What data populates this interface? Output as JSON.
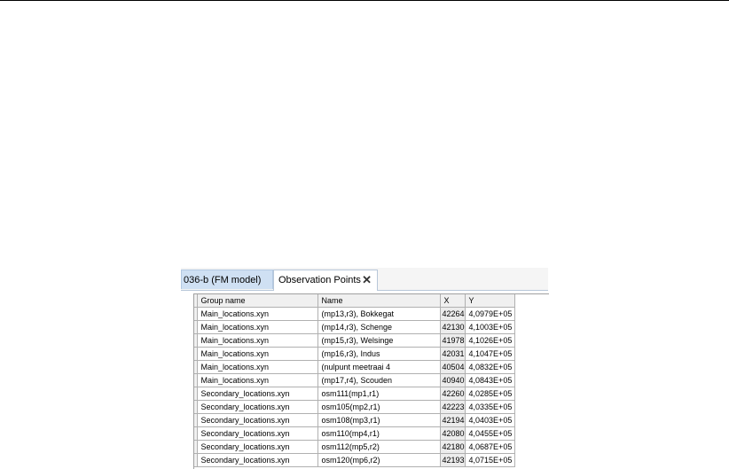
{
  "tabs": [
    {
      "label": "036-b (FM model)"
    },
    {
      "label": "Observation Points",
      "close_glyph": "✕"
    }
  ],
  "table": {
    "columns": [
      "Group name",
      "Name",
      "X",
      "Y"
    ],
    "rows": [
      [
        "Main_locations.xyn",
        "(mp13,r3), Bokkegat",
        "42264",
        "4,0979E+05"
      ],
      [
        "Main_locations.xyn",
        "(mp14,r3), Schenge",
        "42130",
        "4,1003E+05"
      ],
      [
        "Main_locations.xyn",
        "(mp15,r3), Welsinge",
        "41978",
        "4,1026E+05"
      ],
      [
        "Main_locations.xyn",
        "(mp16,r3), Indus",
        "42031",
        "4,1047E+05"
      ],
      [
        "Main_locations.xyn",
        "(nulpunt meetraai 4",
        "40504",
        "4,0832E+05"
      ],
      [
        "Main_locations.xyn",
        "(mp17,r4), Scouden",
        "40940",
        "4,0843E+05"
      ],
      [
        "Secondary_locations.xyn",
        "osm111(mp1,r1)",
        "42260",
        "4,0285E+05"
      ],
      [
        "Secondary_locations.xyn",
        "osm105(mp2,r1)",
        "42223",
        "4,0335E+05"
      ],
      [
        "Secondary_locations.xyn",
        "osm108(mp3,r1)",
        "42194",
        "4,0403E+05"
      ],
      [
        "Secondary_locations.xyn",
        "osm110(mp4,r1)",
        "42080",
        "4,0455E+05"
      ],
      [
        "Secondary_locations.xyn",
        "osm112(mp5,r2)",
        "42180",
        "4,0687E+05"
      ],
      [
        "Secondary_locations.xyn",
        "osm120(mp6,r2)",
        "42193",
        "4,0715E+05"
      ]
    ]
  }
}
